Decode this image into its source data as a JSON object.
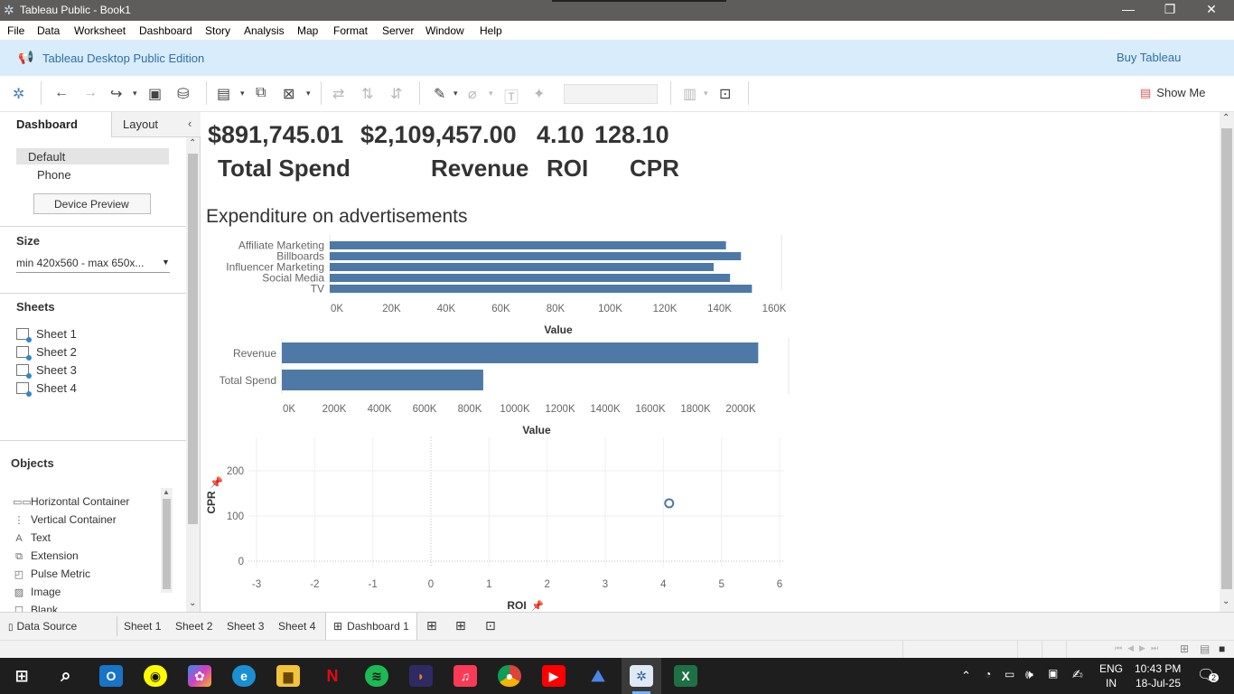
{
  "window": {
    "title": "Tableau Public - Book1"
  },
  "menu": [
    "File",
    "Data",
    "Worksheet",
    "Dashboard",
    "Story",
    "Analysis",
    "Map",
    "Format",
    "Server",
    "Window",
    "Help"
  ],
  "banner": {
    "edition": "Tableau Desktop Public Edition",
    "buy": "Buy Tableau"
  },
  "toolbar": {
    "show_me": "Show Me"
  },
  "left": {
    "tab_dashboard": "Dashboard",
    "tab_layout": "Layout",
    "devices": [
      "Default",
      "Phone"
    ],
    "device_preview": "Device Preview",
    "size_heading": "Size",
    "size_value": "min 420x560 - max 650x...",
    "sheets_heading": "Sheets",
    "sheets": [
      "Sheet 1",
      "Sheet 2",
      "Sheet 3",
      "Sheet 4"
    ],
    "objects_heading": "Objects",
    "objects": [
      "Horizontal Container",
      "Vertical Container",
      "Text",
      "Extension",
      "Pulse Metric",
      "Image",
      "Blank"
    ]
  },
  "kpis": {
    "total_spend_value": "$891,745.01",
    "revenue_value": "$2,109,457.00",
    "roi_value": "4.10",
    "cpr_value": "128.10",
    "total_spend_label": "Total Spend",
    "revenue_label": "Revenue",
    "roi_label": "ROI",
    "cpr_label": "CPR"
  },
  "dashboard_title": "Expenditure on advertisements",
  "chart_data": [
    {
      "type": "bar",
      "orientation": "horizontal",
      "categories": [
        "Affiliate Marketing",
        "Billboards",
        "Influencer Marketing",
        "Social Media",
        "TV"
      ],
      "values": [
        145000,
        150500,
        140500,
        146500,
        154500
      ],
      "xlabel": "Value",
      "xlim": [
        0,
        160000
      ],
      "xticks": [
        "0K",
        "20K",
        "40K",
        "60K",
        "80K",
        "100K",
        "120K",
        "140K",
        "160K"
      ],
      "color": "#4e79a7"
    },
    {
      "type": "bar",
      "orientation": "horizontal",
      "categories": [
        "Revenue",
        "Total Spend"
      ],
      "values": [
        2109457.0,
        891745.01
      ],
      "xlabel": "Value",
      "xlim": [
        0,
        2200000
      ],
      "xticks": [
        "0K",
        "200K",
        "400K",
        "600K",
        "800K",
        "1000K",
        "1200K",
        "1400K",
        "1600K",
        "1800K",
        "2000K"
      ],
      "color": "#4e79a7"
    },
    {
      "type": "scatter",
      "points": [
        {
          "x": 4.1,
          "y": 128.1
        }
      ],
      "xlabel": "ROI",
      "ylabel": "CPR",
      "xlim": [
        -3,
        6
      ],
      "ylim": [
        -20,
        270
      ],
      "xticks": [
        "-3",
        "-2",
        "-1",
        "0",
        "1",
        "2",
        "3",
        "4",
        "5",
        "6"
      ],
      "yticks": [
        "0",
        "100",
        "200"
      ],
      "color": "#4e79a7"
    }
  ],
  "tabs": {
    "data_source": "Data Source",
    "sheets": [
      "Sheet 1",
      "Sheet 2",
      "Sheet 3",
      "Sheet 4"
    ],
    "dashboard": "Dashboard 1"
  },
  "tray": {
    "lang1": "ENG",
    "lang2": "IN",
    "time": "10:43 PM",
    "date": "18-Jul-25",
    "notif": "2"
  },
  "taskbar_apps": [
    "start",
    "search",
    "outlook",
    "snapchat",
    "copilot",
    "edge",
    "file-explorer",
    "netflix",
    "spotify",
    "cricket",
    "apple-music",
    "chrome",
    "youtube",
    "nordvpn",
    "tableau",
    "excel"
  ]
}
